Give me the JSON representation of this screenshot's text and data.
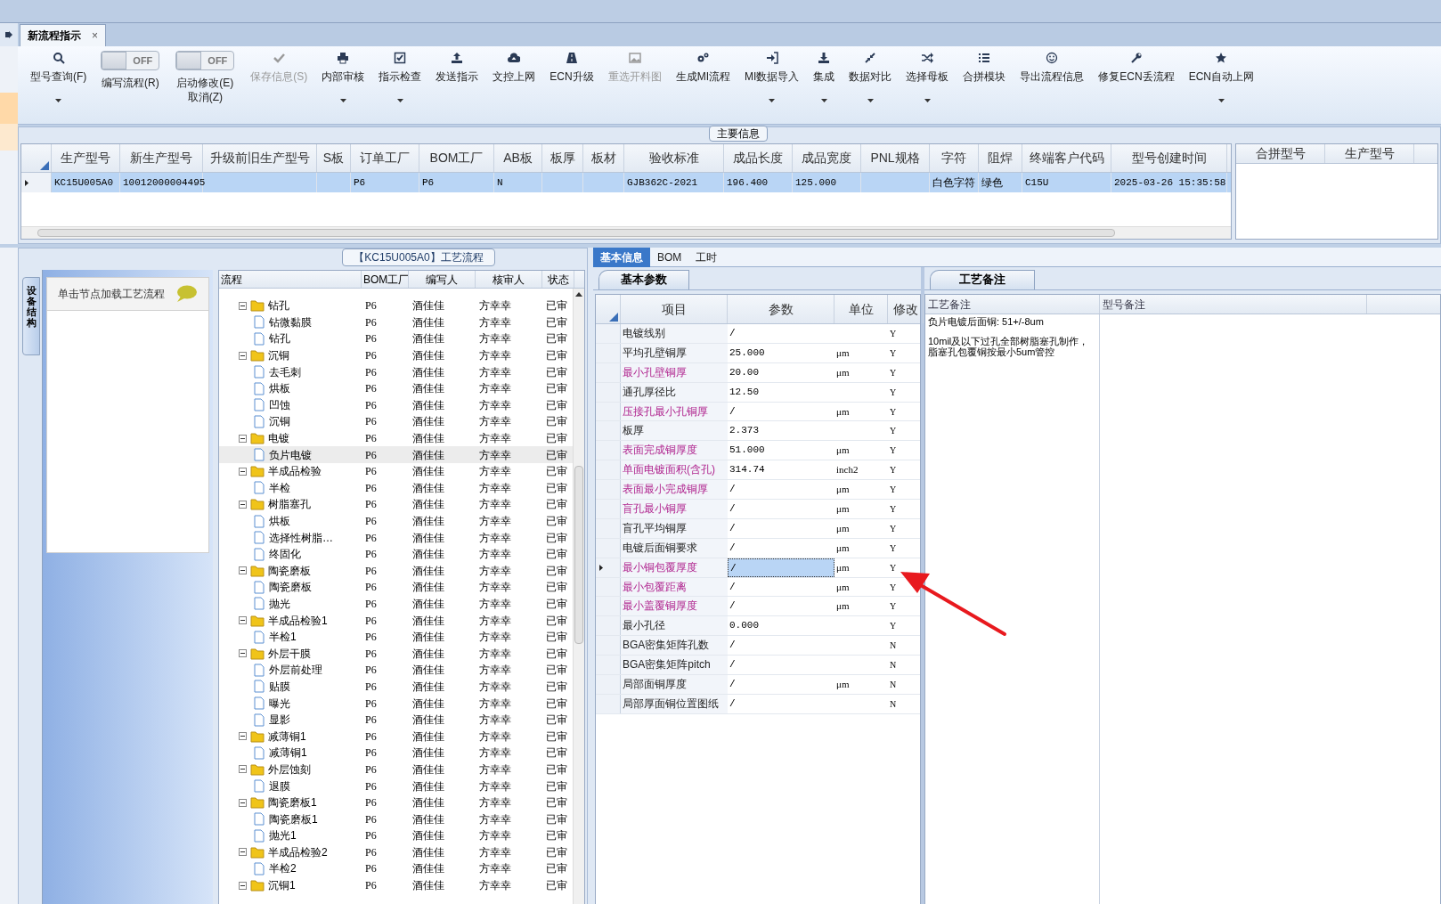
{
  "document_tab": {
    "label": "新流程指示",
    "close": "×",
    "selected": true
  },
  "toolbar": [
    {
      "kind": "button",
      "label": "型号查询(F)",
      "dropdown": true,
      "disabled": false
    },
    {
      "kind": "toggle",
      "label": "编写流程(R)",
      "switch_text": "OFF",
      "on": false
    },
    {
      "kind": "toggle",
      "label": "启动修改(E)",
      "label2": "取消(Z)",
      "switch_text": "OFF",
      "on": false
    },
    {
      "kind": "button",
      "label": "保存信息(S)",
      "dropdown": false,
      "disabled": true
    },
    {
      "kind": "button",
      "label": "内部审核",
      "dropdown": true,
      "disabled": false
    },
    {
      "kind": "button",
      "label": "指示检查",
      "dropdown": true,
      "disabled": false
    },
    {
      "kind": "button",
      "label": "发送指示",
      "dropdown": false,
      "disabled": false
    },
    {
      "kind": "button",
      "label": "文控上网",
      "dropdown": false,
      "disabled": false
    },
    {
      "kind": "button",
      "label": "ECN升级",
      "dropdown": false,
      "disabled": false
    },
    {
      "kind": "button",
      "label": "重选开料图",
      "dropdown": false,
      "disabled": true
    },
    {
      "kind": "button",
      "label": "生成MI流程",
      "dropdown": false,
      "disabled": false
    },
    {
      "kind": "button",
      "label": "MI数据导入",
      "dropdown": true,
      "disabled": false
    },
    {
      "kind": "button",
      "label": "集成",
      "dropdown": true,
      "disabled": false
    },
    {
      "kind": "button",
      "label": "数据对比",
      "dropdown": true,
      "disabled": false
    },
    {
      "kind": "button",
      "label": "选择母板",
      "dropdown": true,
      "disabled": false
    },
    {
      "kind": "button",
      "label": "合拼模块",
      "dropdown": false,
      "disabled": false
    },
    {
      "kind": "button",
      "label": "导出流程信息",
      "dropdown": false,
      "disabled": false
    },
    {
      "kind": "button",
      "label": "修复ECN丢流程",
      "dropdown": false,
      "disabled": false
    },
    {
      "kind": "button",
      "label": "ECN自动上网",
      "dropdown": true,
      "disabled": false
    }
  ],
  "main_info": {
    "title": "主要信息",
    "columns": [
      "生产型号",
      "新生产型号",
      "升级前旧生产型号",
      "S板",
      "订单工厂",
      "BOM工厂",
      "AB板",
      "板厚",
      "板材",
      "验收标准",
      "成品长度",
      "成品宽度",
      "PNL规格",
      "字符",
      "阻焊",
      "终端客户代码",
      "型号创建时间"
    ],
    "rows": [
      {
        "selected": true,
        "cells": [
          "KC15U005A0",
          "10012000004495",
          null,
          null,
          "P6",
          "P6",
          "N",
          null,
          null,
          "GJB362C-2021",
          "196.400",
          "125.000",
          null,
          "白色字符",
          "绿色",
          "C15U",
          "2025-03-26 15:35:58"
        ]
      }
    ],
    "side_columns": [
      "合拼型号",
      "生产型号"
    ]
  },
  "side_panel": {
    "vertical_tab": "设备结构",
    "hint": "单击节点加载工艺流程"
  },
  "process_tree": {
    "title": "【KC15U005A0】工艺流程",
    "columns": [
      "流程",
      "BOM工厂",
      "编写人",
      "核审人",
      "状态"
    ],
    "nodes": [
      {
        "label": "钻孔",
        "bom": "P6",
        "writer": "酒佳佳",
        "reviewer": "方幸幸",
        "status": "已审",
        "expanded": true,
        "selected": false,
        "children": [
          {
            "label": "钻微黏膜",
            "bom": "P6",
            "writer": "酒佳佳",
            "reviewer": "方幸幸",
            "status": "已审",
            "selected": false
          },
          {
            "label": "钻孔",
            "bom": "P6",
            "writer": "酒佳佳",
            "reviewer": "方幸幸",
            "status": "已审",
            "selected": false
          }
        ]
      },
      {
        "label": "沉铜",
        "bom": "P6",
        "writer": "酒佳佳",
        "reviewer": "方幸幸",
        "status": "已审",
        "expanded": true,
        "selected": false,
        "children": [
          {
            "label": "去毛刺",
            "bom": "P6",
            "writer": "酒佳佳",
            "reviewer": "方幸幸",
            "status": "已审",
            "selected": false
          },
          {
            "label": "烘板",
            "bom": "P6",
            "writer": "酒佳佳",
            "reviewer": "方幸幸",
            "status": "已审",
            "selected": false
          },
          {
            "label": "凹蚀",
            "bom": "P6",
            "writer": "酒佳佳",
            "reviewer": "方幸幸",
            "status": "已审",
            "selected": false
          },
          {
            "label": "沉铜",
            "bom": "P6",
            "writer": "酒佳佳",
            "reviewer": "方幸幸",
            "status": "已审",
            "selected": false
          }
        ]
      },
      {
        "label": "电镀",
        "bom": "P6",
        "writer": "酒佳佳",
        "reviewer": "方幸幸",
        "status": "已审",
        "expanded": true,
        "selected": false,
        "children": [
          {
            "label": "负片电镀",
            "bom": "P6",
            "writer": "酒佳佳",
            "reviewer": "方幸幸",
            "status": "已审",
            "selected": true
          }
        ]
      },
      {
        "label": "半成品检验",
        "bom": "P6",
        "writer": "酒佳佳",
        "reviewer": "方幸幸",
        "status": "已审",
        "expanded": true,
        "selected": false,
        "children": [
          {
            "label": "半检",
            "bom": "P6",
            "writer": "酒佳佳",
            "reviewer": "方幸幸",
            "status": "已审",
            "selected": false
          }
        ]
      },
      {
        "label": "树脂塞孔",
        "bom": "P6",
        "writer": "酒佳佳",
        "reviewer": "方幸幸",
        "status": "已审",
        "expanded": true,
        "selected": false,
        "children": [
          {
            "label": "烘板",
            "bom": "P6",
            "writer": "酒佳佳",
            "reviewer": "方幸幸",
            "status": "已审",
            "selected": false
          },
          {
            "label": "选择性树脂…",
            "bom": "P6",
            "writer": "酒佳佳",
            "reviewer": "方幸幸",
            "status": "已审",
            "selected": false
          },
          {
            "label": "终固化",
            "bom": "P6",
            "writer": "酒佳佳",
            "reviewer": "方幸幸",
            "status": "已审",
            "selected": false
          }
        ]
      },
      {
        "label": "陶瓷磨板",
        "bom": "P6",
        "writer": "酒佳佳",
        "reviewer": "方幸幸",
        "status": "已审",
        "expanded": true,
        "selected": false,
        "children": [
          {
            "label": "陶瓷磨板",
            "bom": "P6",
            "writer": "酒佳佳",
            "reviewer": "方幸幸",
            "status": "已审",
            "selected": false
          },
          {
            "label": "抛光",
            "bom": "P6",
            "writer": "酒佳佳",
            "reviewer": "方幸幸",
            "status": "已审",
            "selected": false
          }
        ]
      },
      {
        "label": "半成品检验1",
        "bom": "P6",
        "writer": "酒佳佳",
        "reviewer": "方幸幸",
        "status": "已审",
        "expanded": true,
        "selected": false,
        "children": [
          {
            "label": "半检1",
            "bom": "P6",
            "writer": "酒佳佳",
            "reviewer": "方幸幸",
            "status": "已审",
            "selected": false
          }
        ]
      },
      {
        "label": "外层干膜",
        "bom": "P6",
        "writer": "酒佳佳",
        "reviewer": "方幸幸",
        "status": "已审",
        "expanded": true,
        "selected": false,
        "children": [
          {
            "label": "外层前处理",
            "bom": "P6",
            "writer": "酒佳佳",
            "reviewer": "方幸幸",
            "status": "已审",
            "selected": false
          },
          {
            "label": "贴膜",
            "bom": "P6",
            "writer": "酒佳佳",
            "reviewer": "方幸幸",
            "status": "已审",
            "selected": false
          },
          {
            "label": "曝光",
            "bom": "P6",
            "writer": "酒佳佳",
            "reviewer": "方幸幸",
            "status": "已审",
            "selected": false
          },
          {
            "label": "显影",
            "bom": "P6",
            "writer": "酒佳佳",
            "reviewer": "方幸幸",
            "status": "已审",
            "selected": false
          }
        ]
      },
      {
        "label": "减薄铜1",
        "bom": "P6",
        "writer": "酒佳佳",
        "reviewer": "方幸幸",
        "status": "已审",
        "expanded": true,
        "selected": false,
        "children": [
          {
            "label": "减薄铜1",
            "bom": "P6",
            "writer": "酒佳佳",
            "reviewer": "方幸幸",
            "status": "已审",
            "selected": false
          }
        ]
      },
      {
        "label": "外层蚀刻",
        "bom": "P6",
        "writer": "酒佳佳",
        "reviewer": "方幸幸",
        "status": "已审",
        "expanded": true,
        "selected": false,
        "children": [
          {
            "label": "退膜",
            "bom": "P6",
            "writer": "酒佳佳",
            "reviewer": "方幸幸",
            "status": "已审",
            "selected": false
          }
        ]
      },
      {
        "label": "陶瓷磨板1",
        "bom": "P6",
        "writer": "酒佳佳",
        "reviewer": "方幸幸",
        "status": "已审",
        "expanded": true,
        "selected": false,
        "children": [
          {
            "label": "陶瓷磨板1",
            "bom": "P6",
            "writer": "酒佳佳",
            "reviewer": "方幸幸",
            "status": "已审",
            "selected": false
          },
          {
            "label": "抛光1",
            "bom": "P6",
            "writer": "酒佳佳",
            "reviewer": "方幸幸",
            "status": "已审",
            "selected": false
          }
        ]
      },
      {
        "label": "半成品检验2",
        "bom": "P6",
        "writer": "酒佳佳",
        "reviewer": "方幸幸",
        "status": "已审",
        "expanded": true,
        "selected": false,
        "children": [
          {
            "label": "半检2",
            "bom": "P6",
            "writer": "酒佳佳",
            "reviewer": "方幸幸",
            "status": "已审",
            "selected": false
          }
        ]
      },
      {
        "label": "沉铜1",
        "bom": "P6",
        "writer": "酒佳佳",
        "reviewer": "方幸幸",
        "status": "已审",
        "expanded": true,
        "selected": false
      }
    ]
  },
  "detail_tabs": [
    {
      "label": "基本信息",
      "selected": true
    },
    {
      "label": "BOM",
      "selected": false
    },
    {
      "label": "工时",
      "selected": false
    }
  ],
  "params": {
    "tab": "基本参数",
    "columns": [
      "项目",
      "参数",
      "单位",
      "修改"
    ],
    "rows": [
      {
        "name": "电镀线别",
        "value": "/",
        "modified": "Y",
        "highlight": false,
        "selected": false
      },
      {
        "name": "平均孔壁铜厚",
        "value": "25.000",
        "unit": "μm",
        "modified": "Y",
        "highlight": false,
        "selected": false
      },
      {
        "name": "最小孔壁铜厚",
        "value": "20.00",
        "unit": "μm",
        "modified": "Y",
        "highlight": true,
        "selected": false
      },
      {
        "name": "通孔厚径比",
        "value": "12.50",
        "modified": "Y",
        "highlight": false,
        "selected": false
      },
      {
        "name": "压接孔最小孔铜厚",
        "value": "/",
        "unit": "μm",
        "modified": "Y",
        "highlight": true,
        "selected": false
      },
      {
        "name": "板厚",
        "value": "2.373",
        "modified": "Y",
        "highlight": false,
        "selected": false
      },
      {
        "name": "表面完成铜厚度",
        "value": "51.000",
        "unit": "μm",
        "modified": "Y",
        "highlight": true,
        "selected": false
      },
      {
        "name": "单面电镀面积(含孔)",
        "value": "314.74",
        "unit": "inch2",
        "modified": "Y",
        "highlight": true,
        "selected": false
      },
      {
        "name": "表面最小完成铜厚",
        "value": "/",
        "unit": "μm",
        "modified": "Y",
        "highlight": true,
        "selected": false
      },
      {
        "name": "盲孔最小铜厚",
        "value": "/",
        "unit": "μm",
        "modified": "Y",
        "highlight": true,
        "selected": false
      },
      {
        "name": "盲孔平均铜厚",
        "value": "/",
        "unit": "μm",
        "modified": "Y",
        "highlight": false,
        "selected": false
      },
      {
        "name": "电镀后面铜要求",
        "value": "/",
        "unit": "μm",
        "modified": "Y",
        "highlight": false,
        "selected": false
      },
      {
        "name": "最小铜包覆厚度",
        "value": "/",
        "unit": "μm",
        "modified": "Y",
        "highlight": true,
        "selected": true
      },
      {
        "name": "最小包覆距离",
        "value": "/",
        "unit": "μm",
        "modified": "Y",
        "highlight": true,
        "selected": false
      },
      {
        "name": "最小盖覆铜厚度",
        "value": "/",
        "unit": "μm",
        "modified": "Y",
        "highlight": true,
        "selected": false
      },
      {
        "name": "最小孔径",
        "value": "0.000",
        "modified": "Y",
        "highlight": false,
        "selected": false
      },
      {
        "name": "BGA密集矩阵孔数",
        "value": "/",
        "modified": "N",
        "highlight": false,
        "selected": false
      },
      {
        "name": "BGA密集矩阵pitch",
        "value": "/",
        "modified": "N",
        "highlight": false,
        "selected": false
      },
      {
        "name": "局部面铜厚度",
        "value": "/",
        "unit": "μm",
        "modified": "N",
        "highlight": false,
        "selected": false
      },
      {
        "name": "局部厚面铜位置图纸",
        "value": "/",
        "modified": "N",
        "highlight": false,
        "selected": false
      }
    ]
  },
  "notes": {
    "tab": "工艺备注",
    "columns": [
      "工艺备注",
      "型号备注"
    ],
    "process_notes": [
      "负片电镀后面铜: 51+/-8um",
      "10mil及以下过孔全部树脂塞孔制作，脂塞孔包覆铜按最小5um管控"
    ]
  }
}
